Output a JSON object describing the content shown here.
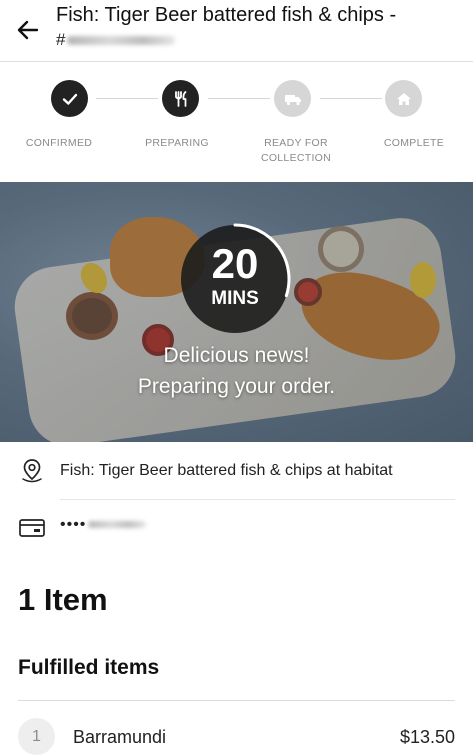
{
  "header": {
    "title": "Fish: Tiger Beer battered fish & chips -",
    "subtitle_prefix": "#"
  },
  "progress": {
    "steps": [
      {
        "label": "CONFIRMED",
        "icon": "check-icon",
        "state": "done"
      },
      {
        "label": "PREPARING",
        "icon": "utensils-icon",
        "state": "done"
      },
      {
        "label": "READY FOR COLLECTION",
        "icon": "truck-icon",
        "state": "pending"
      },
      {
        "label": "COMPLETE",
        "icon": "home-icon",
        "state": "pending"
      }
    ]
  },
  "hero": {
    "timer_value": "20",
    "timer_unit": "MINS",
    "timer_progress": 0.3,
    "message_line1": "Delicious news!",
    "message_line2": "Preparing your order."
  },
  "details": {
    "location_text": "Fish: Tiger Beer battered fish & chips at habitat",
    "payment_masked": "••••"
  },
  "order": {
    "item_count_label": "1 Item",
    "fulfilled_heading": "Fulfilled items",
    "items": [
      {
        "qty": "1",
        "name": "Barramundi",
        "price": "$13.50"
      }
    ]
  },
  "colors": {
    "step_done": "#222222",
    "step_pending": "#d6d6d6",
    "label_gray": "#8a8a8a"
  }
}
